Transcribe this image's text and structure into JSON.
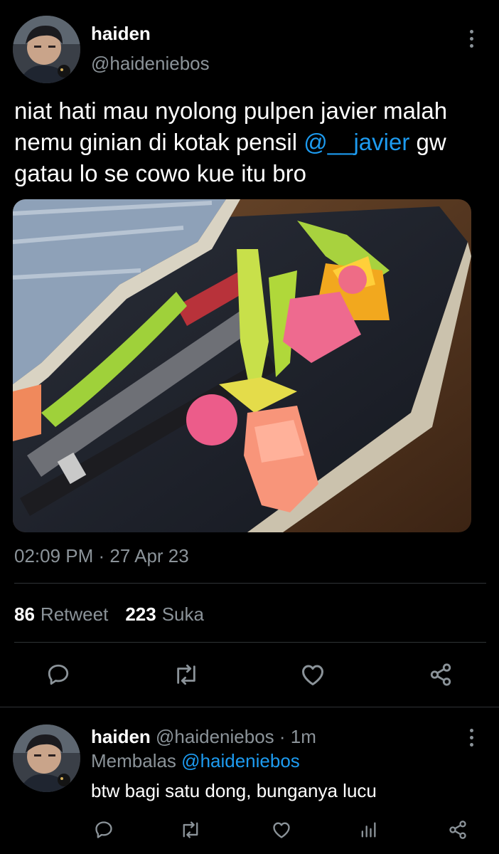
{
  "tweet": {
    "author_name": "haiden",
    "author_handle": "@haideniebos",
    "text_before": "niat hati mau nyolong pulpen javier malah nemu ginian di kotak pensil ",
    "mention": "@__javier",
    "text_after": " gw gatau lo se cowo kue itu bro",
    "time": "02:09 PM",
    "separator": " · ",
    "date": "27 Apr 23",
    "retweets_count": "86",
    "retweets_label": "Retweet",
    "likes_count": "223",
    "likes_label": "Suka"
  },
  "reply": {
    "author_name": "haiden",
    "author_handle": "@haideniebos",
    "separator": " · ",
    "age": "1m",
    "replying_label": "Membalas",
    "replying_to": "@haideniebos",
    "text": "btw bagi satu dong, bunganya lucu"
  },
  "icons": {
    "reply": "comment-icon",
    "retweet": "retweet-icon",
    "like": "heart-icon",
    "share": "share-icon",
    "views": "analytics-icon",
    "more": "more-vertical-icon"
  },
  "colors": {
    "background": "#000000",
    "mention": "#1d9bf0",
    "secondary_text": "#8b9399",
    "divider": "#2f3336"
  }
}
